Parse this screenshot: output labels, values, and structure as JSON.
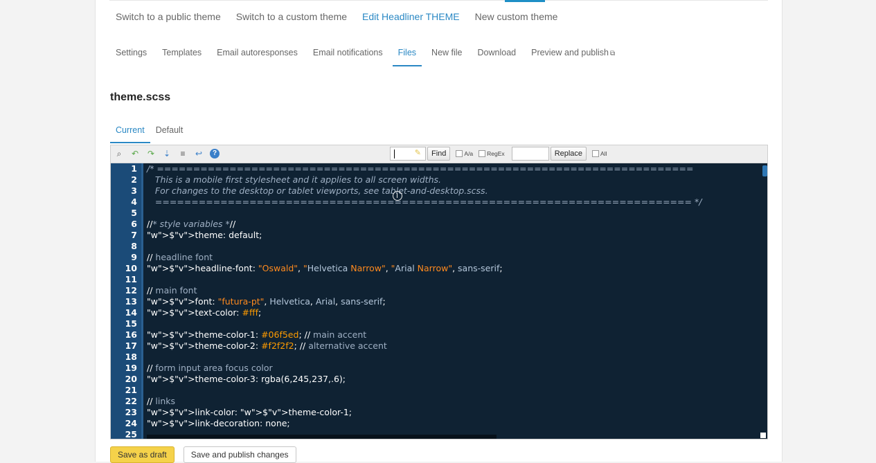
{
  "theme_tabs": [
    {
      "label": "Switch to a public theme"
    },
    {
      "label": "Switch to a custom theme"
    },
    {
      "label": "Edit Headliner THEME"
    },
    {
      "label": "New custom theme"
    }
  ],
  "sub_tabs": [
    {
      "label": "Settings"
    },
    {
      "label": "Templates"
    },
    {
      "label": "Email autoresponses"
    },
    {
      "label": "Email notifications"
    },
    {
      "label": "Files"
    },
    {
      "label": "New file"
    },
    {
      "label": "Download"
    },
    {
      "label": "Preview and publish"
    }
  ],
  "active_theme_tab": "Edit Headliner THEME",
  "active_sub_tab": "Files",
  "file_title": "theme.scss",
  "version_tabs": [
    {
      "label": "Current"
    },
    {
      "label": "Default"
    }
  ],
  "active_version_tab": "Current",
  "toolbar": {
    "icons": [
      "search-replace-icon",
      "undo-icon",
      "redo-icon",
      "go-to-line-icon",
      "reindent-icon",
      "word-wrap-icon",
      "help-icon"
    ],
    "find_label": "Find",
    "case_label": "A/a",
    "regex_label": "RegEx",
    "replace_label": "Replace",
    "all_label": "All"
  },
  "code": {
    "line_numbers": [
      "1",
      "2",
      "3",
      "4",
      "5",
      "6",
      "7",
      "8",
      "9",
      "10",
      "11",
      "12",
      "13",
      "14",
      "15",
      "16",
      "17",
      "18",
      "19",
      "20",
      "21",
      "22",
      "23",
      "24",
      "25"
    ],
    "lines": [
      "/* ==========================================================================",
      "   This is a mobile first stylesheet and it applies to all screen widths.",
      "   For changes to the desktop or tablet viewports, see tablet-and-desktop.scss.",
      "   ========================================================================== */",
      "",
      "//* style variables *//",
      "$theme: default;",
      "",
      "// headline font",
      "$headline-font: \"Oswald\", \"Helvetica Narrow\", \"Arial Narrow\", sans-serif;",
      "",
      "// main font",
      "$font: \"futura-pt\", Helvetica, Arial, sans-serif;",
      "$text-color: #fff;",
      "",
      "$theme-color-1: #06f5ed; // main accent",
      "$theme-color-2: #f2f2f2; // alternative accent",
      "",
      "// form input area focus color",
      "$theme-color-3: rgba(6,245,237,.6);",
      "",
      "// links",
      "$link-color: $theme-color-1;",
      "$link-decoration: none;",
      ""
    ]
  },
  "actions": {
    "draft_label": "Save as draft",
    "publish_label": "Save and publish changes"
  },
  "colors": {
    "accent": "#2a88c4",
    "editor_bg": "#0f2233",
    "gutter_bg": "#1b4b78",
    "draft_button": "#f5d24a",
    "string": "#ff8a1e"
  }
}
